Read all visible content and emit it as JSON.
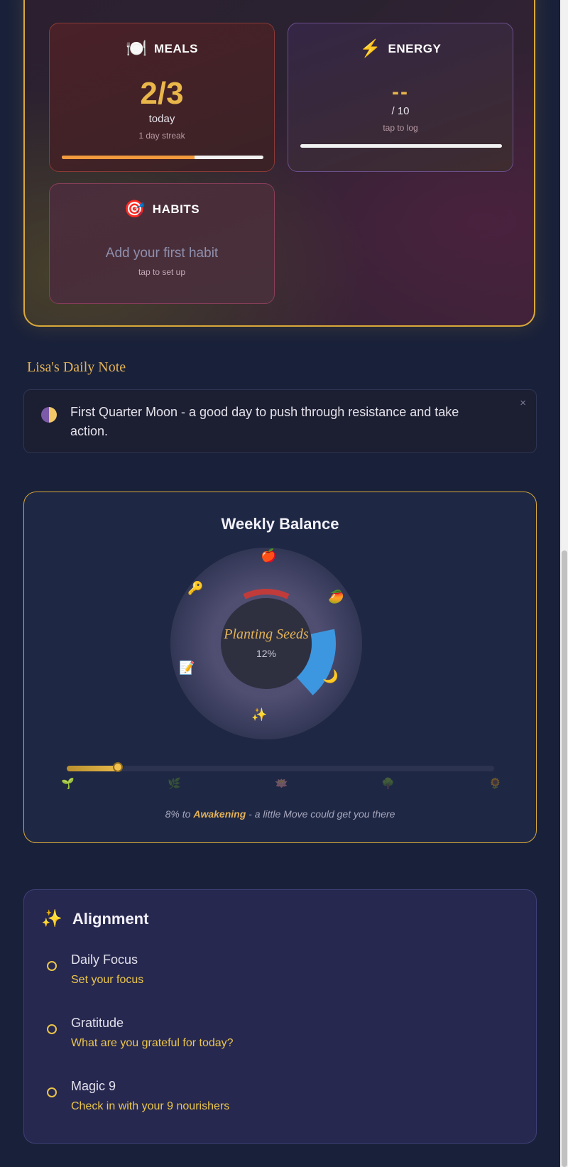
{
  "summary": {
    "meals": {
      "icon": "🍽️",
      "title": "MEALS",
      "value": "2/3",
      "unit": "today",
      "streak": "1 day streak",
      "progress": 0.66
    },
    "energy": {
      "icon": "⚡",
      "title": "ENERGY",
      "value": "--",
      "scale": "/ 10",
      "hint": "tap to log",
      "progress": 0
    },
    "habits": {
      "icon": "🎯",
      "title": "HABITS",
      "empty": "Add your first habit",
      "hint": "tap to set up"
    }
  },
  "note": {
    "heading": "Lisa's Daily Note",
    "text": "First Quarter Moon - a good day to push through resistance and take action.",
    "close": "×"
  },
  "balance": {
    "title": "Weekly Balance",
    "phase": "Planting Seeds",
    "percent": "12%",
    "progress": 0.12,
    "icons": [
      "🍎",
      "🥭",
      "🌙",
      "✨",
      "📝",
      "🔑"
    ],
    "stages": [
      "🌱",
      "🌿",
      "🪷",
      "🌳",
      "🌻"
    ],
    "hint_prefix": "8% to ",
    "hint_target": "Awakening",
    "hint_suffix": " - a little Move could get you there",
    "accent_red": "#c23b3b",
    "accent_blue": "#3c97e0"
  },
  "alignment": {
    "icon": "✨",
    "title": "Alignment",
    "items": [
      {
        "label": "Daily Focus",
        "sub": "Set your focus"
      },
      {
        "label": "Gratitude",
        "sub": "What are you grateful for today?"
      },
      {
        "label": "Magic 9",
        "sub": "Check in with your 9 nourishers"
      }
    ]
  }
}
